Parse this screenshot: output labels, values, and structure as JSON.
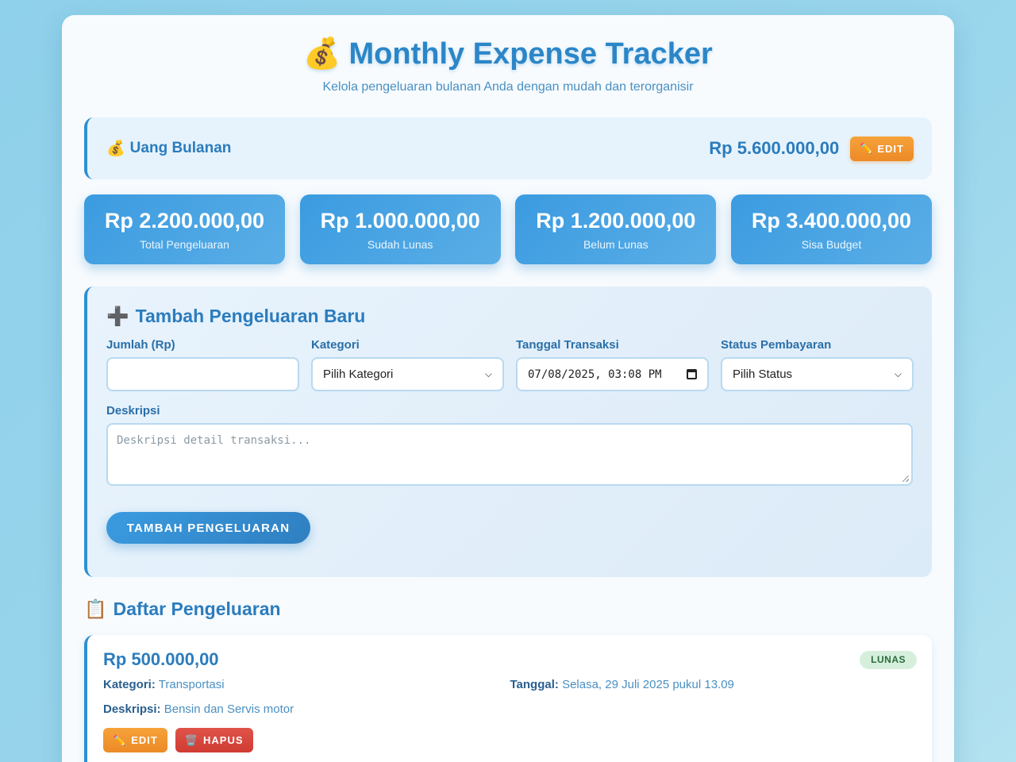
{
  "header": {
    "emoji": "💰",
    "title": "Monthly Expense Tracker",
    "subtitle": "Kelola pengeluaran bulanan Anda dengan mudah dan terorganisir"
  },
  "budget": {
    "emoji": "💰",
    "label": "Uang Bulanan",
    "amount": "Rp 5.600.000,00",
    "edit_label": "EDIT",
    "edit_emoji": "✏️"
  },
  "stats": [
    {
      "value": "Rp 2.200.000,00",
      "label": "Total Pengeluaran"
    },
    {
      "value": "Rp 1.000.000,00",
      "label": "Sudah Lunas"
    },
    {
      "value": "Rp 1.200.000,00",
      "label": "Belum Lunas"
    },
    {
      "value": "Rp 3.400.000,00",
      "label": "Sisa Budget"
    }
  ],
  "form": {
    "emoji": "➕",
    "title": "Tambah Pengeluaran Baru",
    "amount_label": "Jumlah (Rp)",
    "amount_value": "",
    "category_label": "Kategori",
    "category_value": "Pilih Kategori",
    "date_label": "Tanggal Transaksi",
    "date_value": "07/08/2025, 03:08 PM",
    "status_label": "Status Pembayaran",
    "status_value": "Pilih Status",
    "desc_label": "Deskripsi",
    "desc_placeholder": "Deskripsi detail transaksi...",
    "submit_label": "TAMBAH PENGELUARAN"
  },
  "list": {
    "emoji": "📋",
    "title": "Daftar Pengeluaran",
    "items": [
      {
        "amount": "Rp 500.000,00",
        "status": "LUNAS",
        "category_key": "Kategori:",
        "category": "Transportasi",
        "date_key": "Tanggal:",
        "date": "Selasa, 29 Juli 2025 pukul 13.09",
        "desc_key": "Deskripsi:",
        "desc": "Bensin dan Servis motor",
        "edit_emoji": "✏️",
        "edit_label": "EDIT",
        "delete_emoji": "🗑️",
        "delete_label": "HAPUS"
      }
    ]
  },
  "colors": {
    "accent": "#2b86c8",
    "edit_orange": "#ec8a26",
    "delete_red": "#cf3c33",
    "paid_badge": "#d6efdc"
  }
}
